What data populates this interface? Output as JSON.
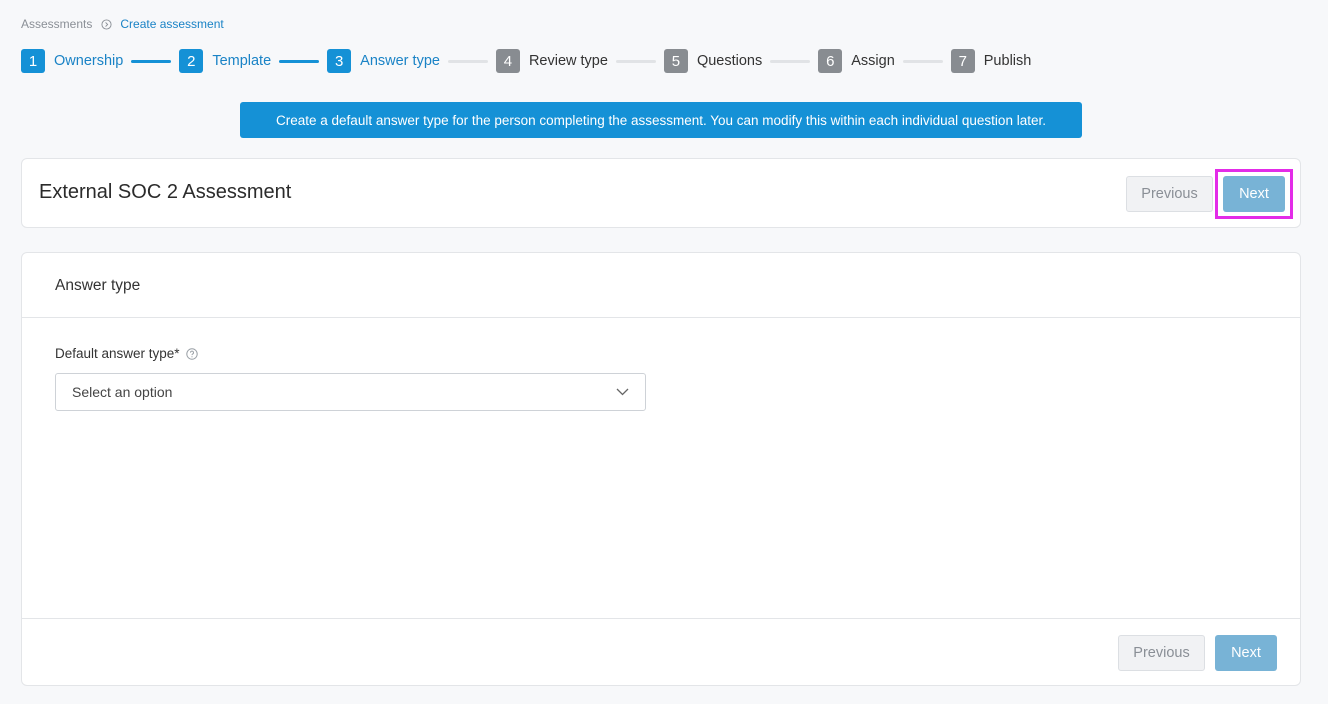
{
  "breadcrumb": {
    "root": "Assessments",
    "current": "Create assessment"
  },
  "stepper": {
    "steps": [
      {
        "num": "1",
        "label": "Ownership",
        "state": "done"
      },
      {
        "num": "2",
        "label": "Template",
        "state": "done"
      },
      {
        "num": "3",
        "label": "Answer type",
        "state": "active"
      },
      {
        "num": "4",
        "label": "Review type",
        "state": "todo"
      },
      {
        "num": "5",
        "label": "Questions",
        "state": "todo"
      },
      {
        "num": "6",
        "label": "Assign",
        "state": "todo"
      },
      {
        "num": "7",
        "label": "Publish",
        "state": "todo"
      }
    ]
  },
  "banner": {
    "text": "Create a default answer type for the person completing the assessment. You can modify this within each individual question later."
  },
  "header": {
    "title": "External SOC 2 Assessment",
    "previous_label": "Previous",
    "next_label": "Next"
  },
  "answer_section": {
    "title": "Answer type",
    "field_label": "Default answer type*",
    "select_value": "Select an option"
  },
  "footer": {
    "previous_label": "Previous",
    "next_label": "Next"
  },
  "colors": {
    "primary": "#1591d6",
    "next_disabled": "#78b3d6",
    "highlight": "#e32ce8",
    "step_inactive": "#888c91"
  },
  "icons": {
    "breadcrumb_separator": "circle-chevron-icon",
    "help": "question-circle-icon",
    "select_caret": "chevron-down-icon"
  }
}
